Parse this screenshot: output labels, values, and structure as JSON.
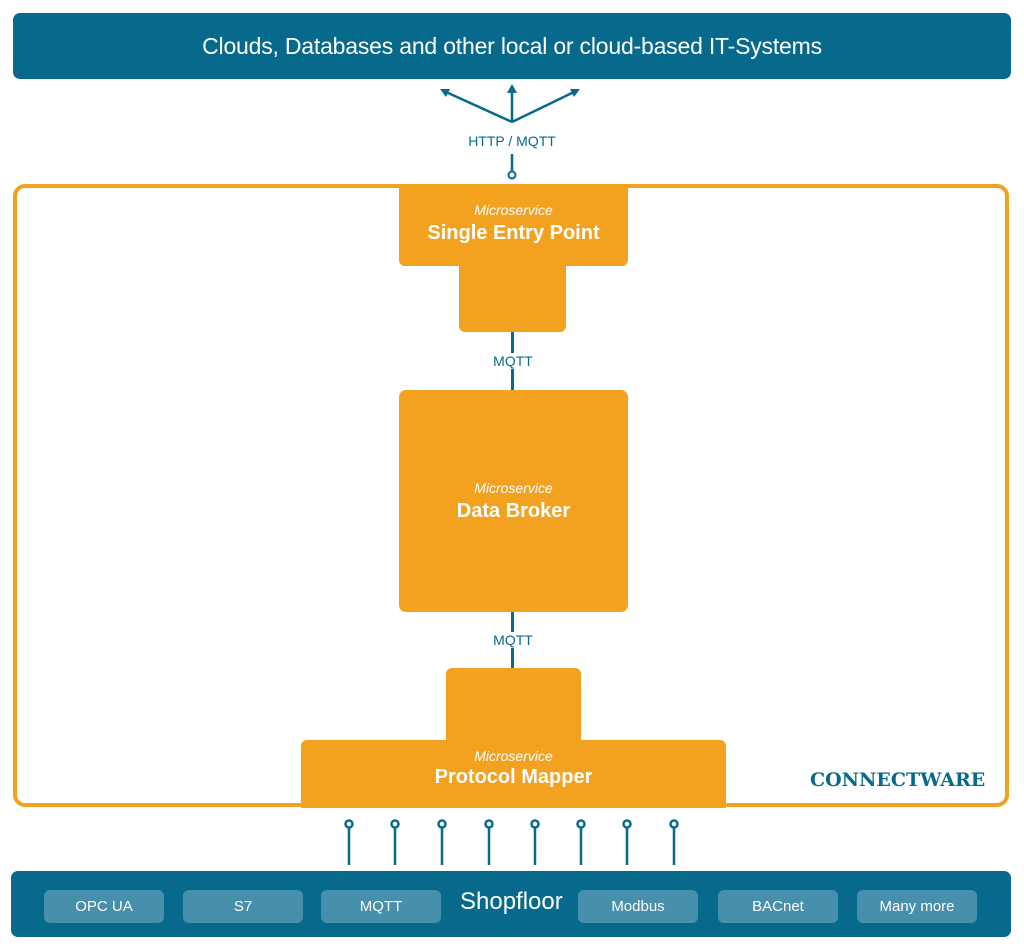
{
  "top_system": {
    "label": "Clouds, Databases and other local or cloud-based IT-Systems"
  },
  "connections": {
    "upstream": "HTTP / MQTT",
    "entry_to_broker": "MQTT",
    "broker_to_mapper": "MQTT"
  },
  "platform": {
    "brand": "CONNECTWARE"
  },
  "microservices": [
    {
      "kind": "Microservice",
      "name": "Single Entry Point"
    },
    {
      "kind": "Microservice",
      "name": "Data Broker"
    },
    {
      "kind": "Microservice",
      "name": "Protocol Mapper"
    }
  ],
  "shopfloor": {
    "label": "Shopfloor",
    "protocols": [
      "OPC UA",
      "S7",
      "MQTT",
      "Modbus",
      "BACnet",
      "Many more"
    ]
  },
  "colors": {
    "primary_blue": "#076a8c",
    "accent_orange": "#f3a21f",
    "chip_blue": "#4690ab"
  }
}
